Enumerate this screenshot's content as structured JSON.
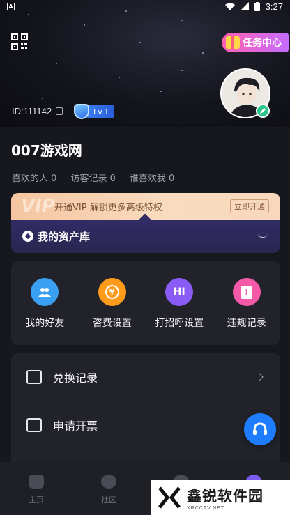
{
  "status_bar": {
    "time": "3:27",
    "notification_icon": "a-icon"
  },
  "header": {
    "task_center_label": "任务中心",
    "user_id": "ID:111142",
    "level": "Lv.1"
  },
  "profile": {
    "site_name": "007游戏网"
  },
  "stats": [
    {
      "label": "喜欢的人",
      "count": "0"
    },
    {
      "label": "访客记录",
      "count": "0"
    },
    {
      "label": "谁喜欢我",
      "count": "0"
    }
  ],
  "vip": {
    "mark": "VIP",
    "promo_text": "开通VIP 解锁更多高级特权",
    "open_button": "立即开通",
    "assets_title": "我的资产库"
  },
  "quick_actions": [
    {
      "label": "我的好友",
      "icon": "friends-icon",
      "color": "#3aa0f3",
      "glyph": "👥"
    },
    {
      "label": "咨费设置",
      "icon": "fee-icon",
      "color": "#ff9b1a",
      "glyph": "¥"
    },
    {
      "label": "打招呼设置",
      "icon": "greeting-icon",
      "color": "#8a5cf5",
      "glyph": "HI"
    },
    {
      "label": "违规记录",
      "icon": "violation-icon",
      "color": "#f45aa8",
      "glyph": "!"
    }
  ],
  "menu": [
    {
      "label": "兑换记录",
      "icon": "gift-box-icon"
    },
    {
      "label": "申请开票",
      "icon": "ticket-icon"
    }
  ],
  "tabs": [
    {
      "label": "主页",
      "icon": "home-icon"
    },
    {
      "label": "社区",
      "icon": "planet-icon"
    },
    {
      "label": "",
      "icon": "chat-icon"
    },
    {
      "label": "",
      "icon": "profile-icon"
    }
  ],
  "watermark": {
    "title": "鑫锐软件园",
    "subtitle": "XRCCTV.NET"
  }
}
